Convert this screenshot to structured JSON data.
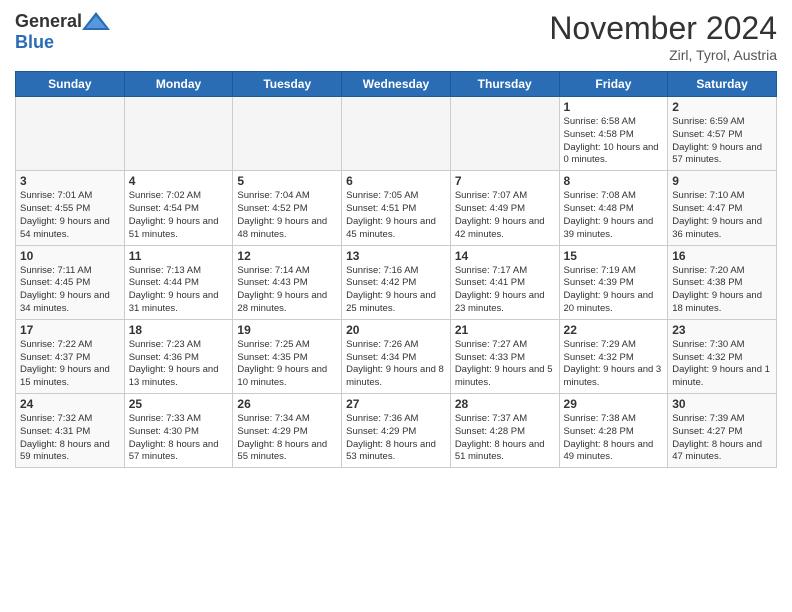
{
  "header": {
    "logo_general": "General",
    "logo_blue": "Blue",
    "month_title": "November 2024",
    "location": "Zirl, Tyrol, Austria"
  },
  "days_of_week": [
    "Sunday",
    "Monday",
    "Tuesday",
    "Wednesday",
    "Thursday",
    "Friday",
    "Saturday"
  ],
  "weeks": [
    [
      {
        "day": "",
        "info": ""
      },
      {
        "day": "",
        "info": ""
      },
      {
        "day": "",
        "info": ""
      },
      {
        "day": "",
        "info": ""
      },
      {
        "day": "",
        "info": ""
      },
      {
        "day": "1",
        "info": "Sunrise: 6:58 AM\nSunset: 4:58 PM\nDaylight: 10 hours and 0 minutes."
      },
      {
        "day": "2",
        "info": "Sunrise: 6:59 AM\nSunset: 4:57 PM\nDaylight: 9 hours and 57 minutes."
      }
    ],
    [
      {
        "day": "3",
        "info": "Sunrise: 7:01 AM\nSunset: 4:55 PM\nDaylight: 9 hours and 54 minutes."
      },
      {
        "day": "4",
        "info": "Sunrise: 7:02 AM\nSunset: 4:54 PM\nDaylight: 9 hours and 51 minutes."
      },
      {
        "day": "5",
        "info": "Sunrise: 7:04 AM\nSunset: 4:52 PM\nDaylight: 9 hours and 48 minutes."
      },
      {
        "day": "6",
        "info": "Sunrise: 7:05 AM\nSunset: 4:51 PM\nDaylight: 9 hours and 45 minutes."
      },
      {
        "day": "7",
        "info": "Sunrise: 7:07 AM\nSunset: 4:49 PM\nDaylight: 9 hours and 42 minutes."
      },
      {
        "day": "8",
        "info": "Sunrise: 7:08 AM\nSunset: 4:48 PM\nDaylight: 9 hours and 39 minutes."
      },
      {
        "day": "9",
        "info": "Sunrise: 7:10 AM\nSunset: 4:47 PM\nDaylight: 9 hours and 36 minutes."
      }
    ],
    [
      {
        "day": "10",
        "info": "Sunrise: 7:11 AM\nSunset: 4:45 PM\nDaylight: 9 hours and 34 minutes."
      },
      {
        "day": "11",
        "info": "Sunrise: 7:13 AM\nSunset: 4:44 PM\nDaylight: 9 hours and 31 minutes."
      },
      {
        "day": "12",
        "info": "Sunrise: 7:14 AM\nSunset: 4:43 PM\nDaylight: 9 hours and 28 minutes."
      },
      {
        "day": "13",
        "info": "Sunrise: 7:16 AM\nSunset: 4:42 PM\nDaylight: 9 hours and 25 minutes."
      },
      {
        "day": "14",
        "info": "Sunrise: 7:17 AM\nSunset: 4:41 PM\nDaylight: 9 hours and 23 minutes."
      },
      {
        "day": "15",
        "info": "Sunrise: 7:19 AM\nSunset: 4:39 PM\nDaylight: 9 hours and 20 minutes."
      },
      {
        "day": "16",
        "info": "Sunrise: 7:20 AM\nSunset: 4:38 PM\nDaylight: 9 hours and 18 minutes."
      }
    ],
    [
      {
        "day": "17",
        "info": "Sunrise: 7:22 AM\nSunset: 4:37 PM\nDaylight: 9 hours and 15 minutes."
      },
      {
        "day": "18",
        "info": "Sunrise: 7:23 AM\nSunset: 4:36 PM\nDaylight: 9 hours and 13 minutes."
      },
      {
        "day": "19",
        "info": "Sunrise: 7:25 AM\nSunset: 4:35 PM\nDaylight: 9 hours and 10 minutes."
      },
      {
        "day": "20",
        "info": "Sunrise: 7:26 AM\nSunset: 4:34 PM\nDaylight: 9 hours and 8 minutes."
      },
      {
        "day": "21",
        "info": "Sunrise: 7:27 AM\nSunset: 4:33 PM\nDaylight: 9 hours and 5 minutes."
      },
      {
        "day": "22",
        "info": "Sunrise: 7:29 AM\nSunset: 4:32 PM\nDaylight: 9 hours and 3 minutes."
      },
      {
        "day": "23",
        "info": "Sunrise: 7:30 AM\nSunset: 4:32 PM\nDaylight: 9 hours and 1 minute."
      }
    ],
    [
      {
        "day": "24",
        "info": "Sunrise: 7:32 AM\nSunset: 4:31 PM\nDaylight: 8 hours and 59 minutes."
      },
      {
        "day": "25",
        "info": "Sunrise: 7:33 AM\nSunset: 4:30 PM\nDaylight: 8 hours and 57 minutes."
      },
      {
        "day": "26",
        "info": "Sunrise: 7:34 AM\nSunset: 4:29 PM\nDaylight: 8 hours and 55 minutes."
      },
      {
        "day": "27",
        "info": "Sunrise: 7:36 AM\nSunset: 4:29 PM\nDaylight: 8 hours and 53 minutes."
      },
      {
        "day": "28",
        "info": "Sunrise: 7:37 AM\nSunset: 4:28 PM\nDaylight: 8 hours and 51 minutes."
      },
      {
        "day": "29",
        "info": "Sunrise: 7:38 AM\nSunset: 4:28 PM\nDaylight: 8 hours and 49 minutes."
      },
      {
        "day": "30",
        "info": "Sunrise: 7:39 AM\nSunset: 4:27 PM\nDaylight: 8 hours and 47 minutes."
      }
    ]
  ]
}
